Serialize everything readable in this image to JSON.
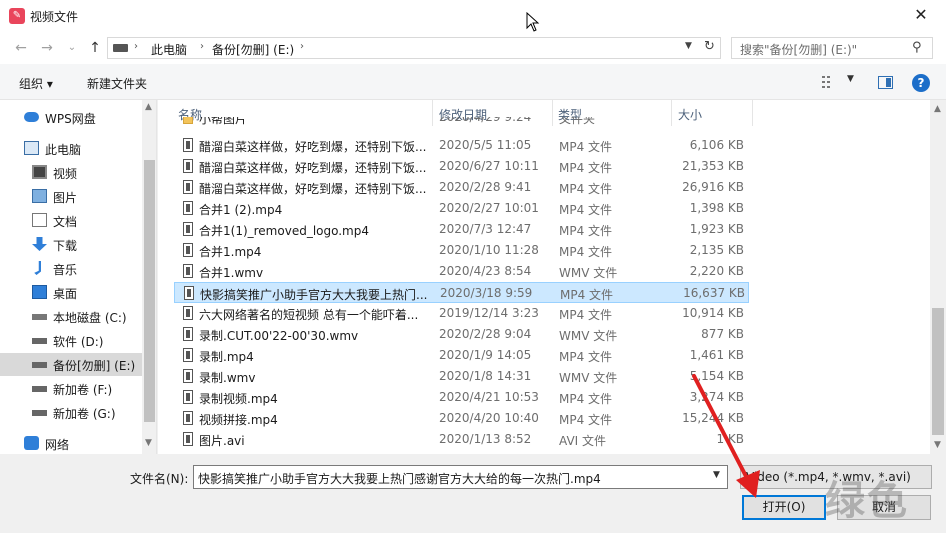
{
  "window": {
    "title": "视频文件",
    "close": "✕"
  },
  "nav": {
    "back": "←",
    "forward": "→",
    "dropdown": "⌄",
    "up": "↑",
    "breadcrumbs": [
      "此电脑",
      "备份[勿删] (E:)"
    ],
    "search_placeholder": "搜索\"备份[勿删] (E:)\""
  },
  "toolbar": {
    "organize": "组织 ▾",
    "new_folder": "新建文件夹"
  },
  "sidebar": {
    "items": [
      {
        "label": "WPS网盘",
        "icon": "cloud-icon"
      },
      {
        "label": "此电脑",
        "icon": "computer-icon"
      },
      {
        "label": "视频",
        "icon": "video-folder-icon"
      },
      {
        "label": "图片",
        "icon": "pictures-folder-icon"
      },
      {
        "label": "文档",
        "icon": "documents-folder-icon"
      },
      {
        "label": "下载",
        "icon": "download-icon"
      },
      {
        "label": "音乐",
        "icon": "music-icon"
      },
      {
        "label": "桌面",
        "icon": "desktop-icon"
      },
      {
        "label": "本地磁盘 (C:)",
        "icon": "windows-drive-icon"
      },
      {
        "label": "软件 (D:)",
        "icon": "drive-icon"
      },
      {
        "label": "备份[勿删] (E:)",
        "icon": "drive-icon",
        "selected": true
      },
      {
        "label": "新加卷 (F:)",
        "icon": "drive-icon"
      },
      {
        "label": "新加卷 (G:)",
        "icon": "drive-icon"
      },
      {
        "label": "网络",
        "icon": "network-icon"
      }
    ]
  },
  "columns": {
    "name": "名称",
    "date": "修改日期",
    "type": "类型",
    "size": "大小"
  },
  "files": [
    {
      "name": "小帮图片",
      "date": "2020/4/29 9:24",
      "type": "文件夹",
      "size": "",
      "folder": true
    },
    {
      "name": "醋溜白菜这样做，好吃到爆，还特别下饭...",
      "date": "2020/5/5 11:05",
      "type": "MP4 文件",
      "size": "6,106 KB"
    },
    {
      "name": "醋溜白菜这样做，好吃到爆，还特别下饭...",
      "date": "2020/6/27 10:11",
      "type": "MP4 文件",
      "size": "21,353 KB"
    },
    {
      "name": "醋溜白菜这样做，好吃到爆，还特别下饭...",
      "date": "2020/2/28 9:41",
      "type": "MP4 文件",
      "size": "26,916 KB"
    },
    {
      "name": "合并1 (2).mp4",
      "date": "2020/2/27 10:01",
      "type": "MP4 文件",
      "size": "1,398 KB"
    },
    {
      "name": "合并1(1)_removed_logo.mp4",
      "date": "2020/7/3 12:47",
      "type": "MP4 文件",
      "size": "1,923 KB"
    },
    {
      "name": "合并1.mp4",
      "date": "2020/1/10 11:28",
      "type": "MP4 文件",
      "size": "2,135 KB"
    },
    {
      "name": "合并1.wmv",
      "date": "2020/4/23 8:54",
      "type": "WMV 文件",
      "size": "2,220 KB"
    },
    {
      "name": "快影搞笑推广小助手官方大大我要上热门...",
      "date": "2020/3/18 9:59",
      "type": "MP4 文件",
      "size": "16,637 KB",
      "selected": true
    },
    {
      "name": "六大网络著名的短视频 总有一个能吓着...",
      "date": "2019/12/14 3:23",
      "type": "MP4 文件",
      "size": "10,914 KB"
    },
    {
      "name": "录制.CUT.00'22-00'30.wmv",
      "date": "2020/2/28 9:04",
      "type": "WMV 文件",
      "size": "877 KB"
    },
    {
      "name": "录制.mp4",
      "date": "2020/1/9 14:05",
      "type": "MP4 文件",
      "size": "1,461 KB"
    },
    {
      "name": "录制.wmv",
      "date": "2020/1/8 14:31",
      "type": "WMV 文件",
      "size": "5,154 KB"
    },
    {
      "name": "录制视频.mp4",
      "date": "2020/4/21 10:53",
      "type": "MP4 文件",
      "size": "3,274 KB"
    },
    {
      "name": "视频拼接.mp4",
      "date": "2020/4/20 10:40",
      "type": "MP4 文件",
      "size": "15,244 KB"
    },
    {
      "name": "图片.avi",
      "date": "2020/1/13 8:52",
      "type": "AVI 文件",
      "size": "1 KB"
    }
  ],
  "bottom": {
    "filename_label": "文件名(N):",
    "filename_value": "快影搞笑推广小助手官方大大我要上热门感谢官方大大给的每一次热门.mp4",
    "filter_value": "Video (*.mp4, *.wmv, *.avi)",
    "open_label": "打开(O)",
    "cancel_label": "取消"
  },
  "watermark": "绿色",
  "colors": {
    "accent": "#0078d7",
    "selection": "#cce8ff",
    "annotation": "#e02020"
  }
}
